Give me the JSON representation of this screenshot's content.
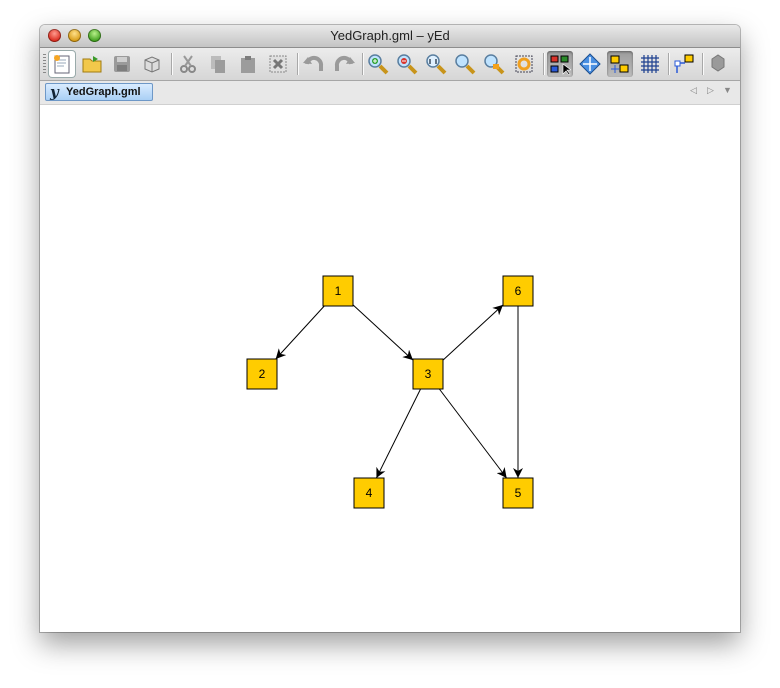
{
  "window": {
    "title": "YedGraph.gml – yEd"
  },
  "toolbar": {
    "buttons": [
      {
        "icon": "new-document-icon"
      },
      {
        "icon": "open-folder-icon"
      },
      {
        "icon": "save-disk-icon"
      },
      {
        "icon": "export-box-icon"
      },
      {
        "icon": "cut-scissors-icon"
      },
      {
        "icon": "copy-icon"
      },
      {
        "icon": "paste-icon"
      },
      {
        "icon": "delete-icon"
      },
      {
        "icon": "undo-icon"
      },
      {
        "icon": "redo-icon"
      },
      {
        "icon": "zoom-in-icon"
      },
      {
        "icon": "zoom-out-icon"
      },
      {
        "icon": "zoom-1to1-icon"
      },
      {
        "icon": "zoom-icon"
      },
      {
        "icon": "zoom-selection-icon"
      },
      {
        "icon": "fit-content-icon"
      },
      {
        "icon": "edit-mode-icon"
      },
      {
        "icon": "navigation-mode-icon"
      },
      {
        "icon": "snap-lines-icon"
      },
      {
        "icon": "grid-icon"
      },
      {
        "icon": "ports-icon"
      },
      {
        "icon": "plugin-icon"
      }
    ]
  },
  "tabs": [
    {
      "label": "YedGraph.gml",
      "logo": "y"
    }
  ],
  "graph": {
    "nodes": [
      {
        "id": "1",
        "label": "1"
      },
      {
        "id": "2",
        "label": "2"
      },
      {
        "id": "3",
        "label": "3"
      },
      {
        "id": "4",
        "label": "4"
      },
      {
        "id": "5",
        "label": "5"
      },
      {
        "id": "6",
        "label": "6"
      }
    ],
    "edges": [
      {
        "source": "1",
        "target": "2"
      },
      {
        "source": "1",
        "target": "3"
      },
      {
        "source": "3",
        "target": "4"
      },
      {
        "source": "3",
        "target": "5"
      },
      {
        "source": "3",
        "target": "6"
      },
      {
        "source": "6",
        "target": "5"
      }
    ],
    "colors": {
      "node_fill": "#ffcc00",
      "node_stroke": "#000000",
      "edge": "#000000"
    }
  }
}
